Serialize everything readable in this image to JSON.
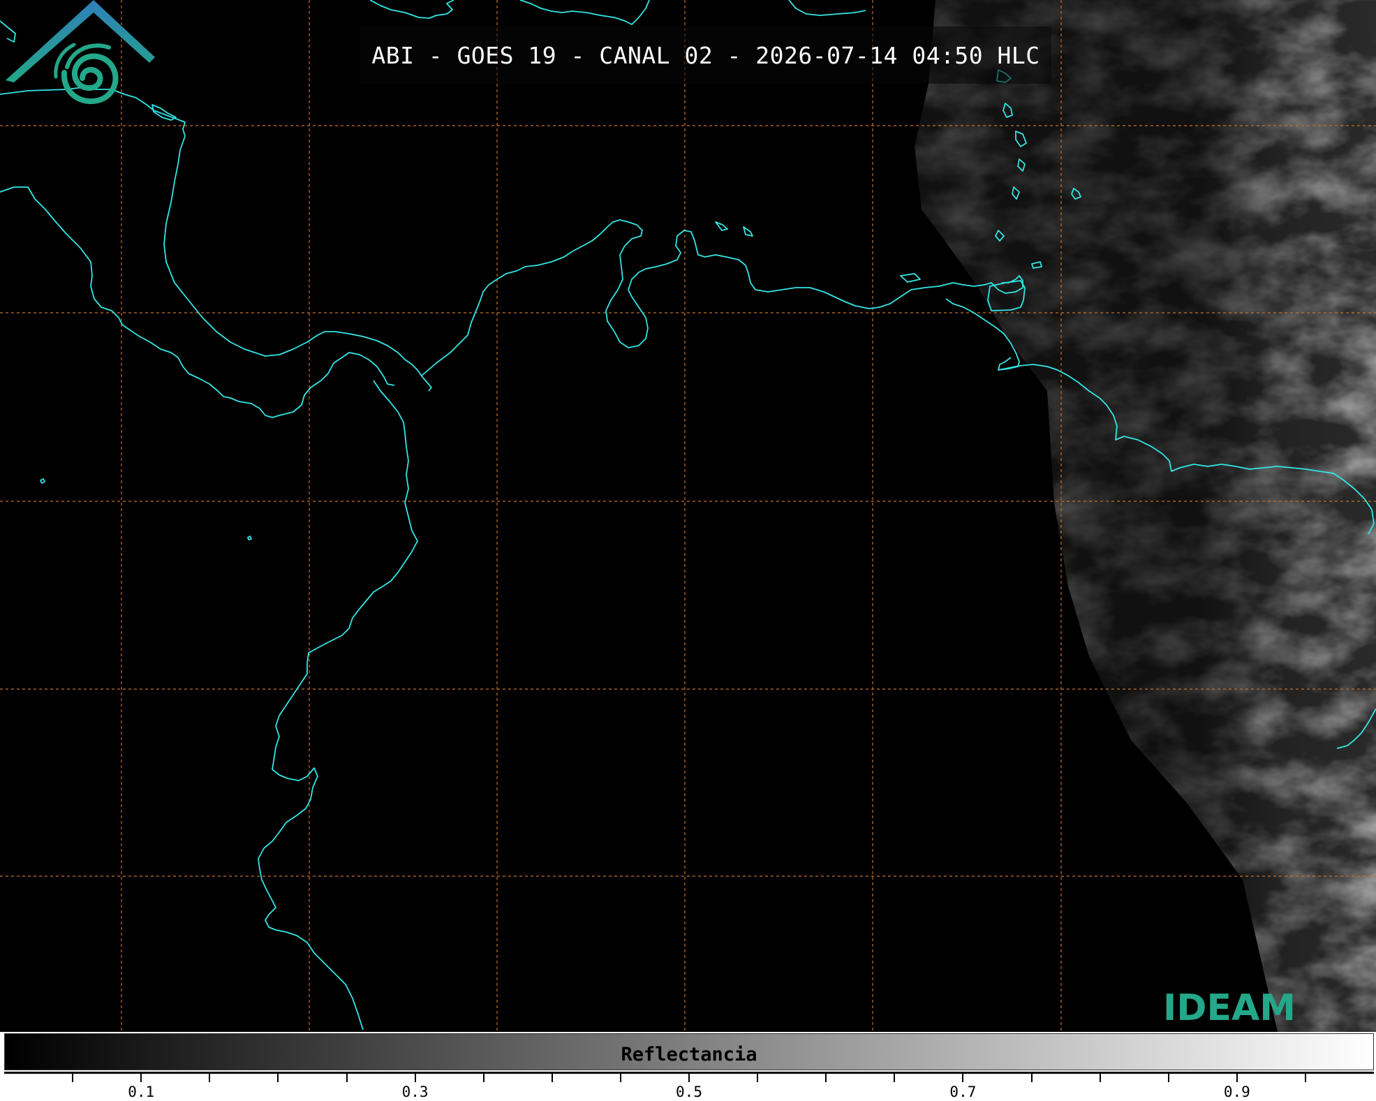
{
  "title": "ABI - GOES 19 - CANAL 02 - 2026-07-14 04:50 HLC",
  "logo": {
    "text": "IDEAM",
    "colors": {
      "blue": "#2f7fb8",
      "green": "#23a889"
    }
  },
  "colorbar": {
    "label": "Reflectancia",
    "ticks": [
      {
        "label": "0.1"
      },
      {
        "label": "0.3"
      },
      {
        "label": "0.5"
      },
      {
        "label": "0.7"
      },
      {
        "label": "0.9"
      }
    ],
    "color_low": "#000000",
    "color_high": "#ffffff"
  },
  "map": {
    "coastline_color": "#33e6e6",
    "gridline_color": "#c8722a",
    "background_color": "#000000"
  }
}
